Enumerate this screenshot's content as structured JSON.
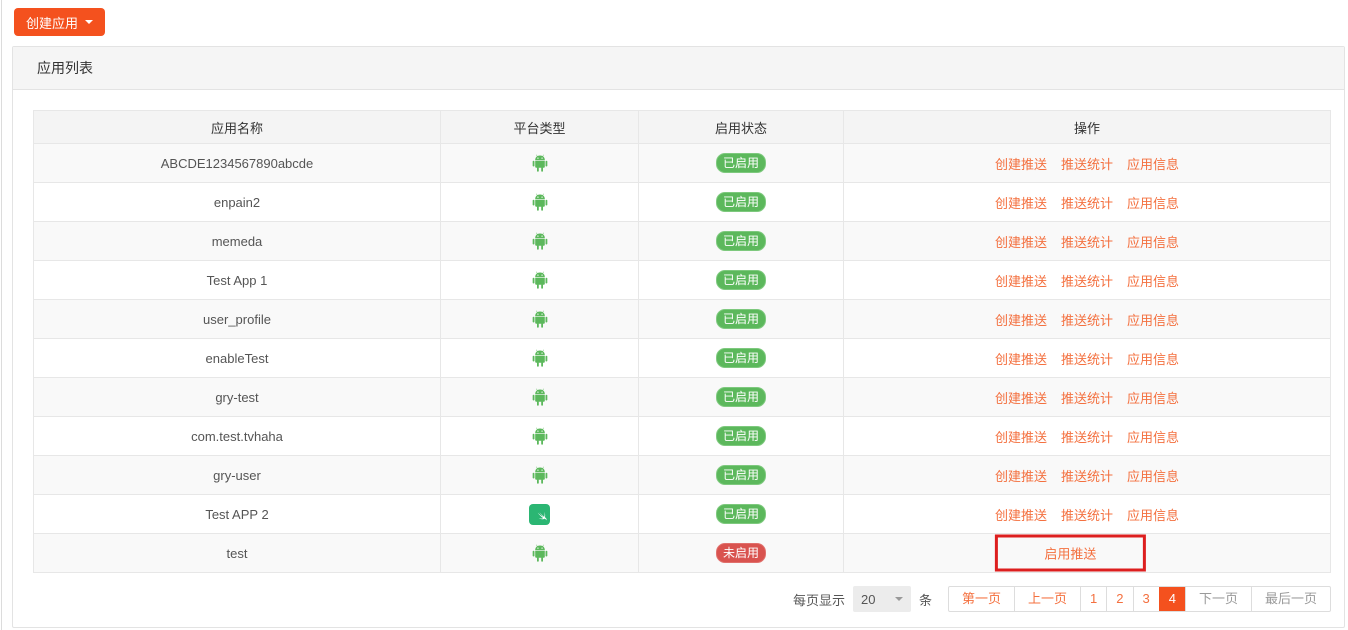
{
  "page": {
    "create_button_label": "创建应用",
    "panel_title": "应用列表"
  },
  "table": {
    "columns": [
      "应用名称",
      "平台类型",
      "启用状态",
      "操作"
    ],
    "status_labels": {
      "enabled": "已启用",
      "disabled": "未启用"
    },
    "action_labels": {
      "create_push": "创建推送",
      "push_stats": "推送统计",
      "app_info": "应用信息",
      "enable_push": "启用推送"
    },
    "platform_icons": {
      "android": "android-icon",
      "swift": "swift-icon"
    },
    "rows": [
      {
        "name": "ABCDE1234567890abcde",
        "platform": "android",
        "status": "enabled"
      },
      {
        "name": "enpain2",
        "platform": "android",
        "status": "enabled"
      },
      {
        "name": "memeda",
        "platform": "android",
        "status": "enabled"
      },
      {
        "name": "Test App 1",
        "platform": "android",
        "status": "enabled"
      },
      {
        "name": "user_profile",
        "platform": "android",
        "status": "enabled"
      },
      {
        "name": "enableTest",
        "platform": "android",
        "status": "enabled"
      },
      {
        "name": "gry-test",
        "platform": "android",
        "status": "enabled"
      },
      {
        "name": "com.test.tvhaha",
        "platform": "android",
        "status": "enabled"
      },
      {
        "name": "gry-user",
        "platform": "android",
        "status": "enabled"
      },
      {
        "name": "Test APP 2",
        "platform": "swift",
        "status": "enabled"
      },
      {
        "name": "test",
        "platform": "android",
        "status": "disabled",
        "highlighted": true
      }
    ]
  },
  "pagination": {
    "page_size_label": "每页显示",
    "page_size_value": "20",
    "unit_label": "条",
    "buttons": [
      {
        "label": "第一页",
        "state": "normal"
      },
      {
        "label": "上一页",
        "state": "normal"
      },
      {
        "label": "1",
        "state": "normal"
      },
      {
        "label": "2",
        "state": "normal"
      },
      {
        "label": "3",
        "state": "normal"
      },
      {
        "label": "4",
        "state": "active"
      },
      {
        "label": "下一页",
        "state": "disabled"
      },
      {
        "label": "最后一页",
        "state": "disabled"
      }
    ]
  },
  "colors": {
    "accent_orange": "#f4511e",
    "link_orange": "#f4703f",
    "success_green": "#5cb85c",
    "danger_red": "#d9534f",
    "annotation_red": "#dd1f1f",
    "swift_green": "#2bb673"
  }
}
